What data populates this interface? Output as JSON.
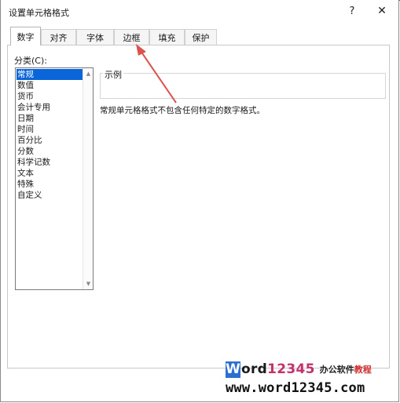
{
  "window": {
    "title": "设置单元格格式",
    "help_glyph": "?",
    "close_glyph": "✕"
  },
  "tabs": [
    {
      "label": "数字",
      "active": true
    },
    {
      "label": "对齐",
      "active": false
    },
    {
      "label": "字体",
      "active": false
    },
    {
      "label": "边框",
      "active": false
    },
    {
      "label": "填充",
      "active": false
    },
    {
      "label": "保护",
      "active": false
    }
  ],
  "category": {
    "label": "分类(C):",
    "items": [
      "常规",
      "数值",
      "货币",
      "会计专用",
      "日期",
      "时间",
      "百分比",
      "分数",
      "科学记数",
      "文本",
      "特殊",
      "自定义"
    ],
    "selected": "常规"
  },
  "sample": {
    "label": "示例",
    "value": ""
  },
  "description": "常规单元格格式不包含任何特定的数字格式。",
  "annotation_arrow": {
    "color": "#d9534f",
    "points_to": "边框"
  },
  "watermark": {
    "brand_w": "W",
    "brand_ord": "ord",
    "brand_digits": "12345",
    "cn_left": "办公软件",
    "cn_right": "教程",
    "url": "www.word12345.com"
  }
}
